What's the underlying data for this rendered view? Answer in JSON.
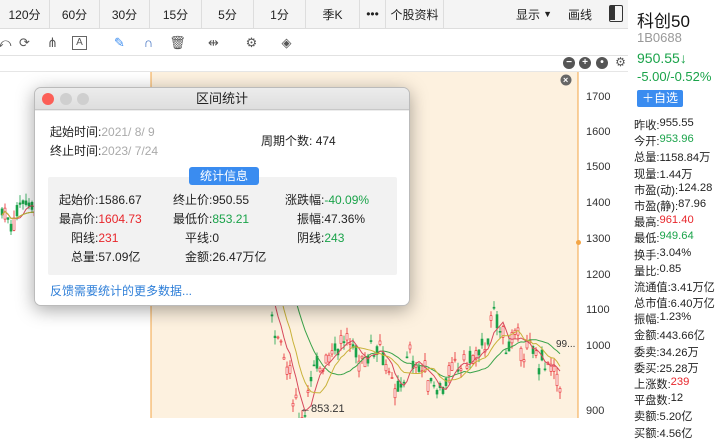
{
  "period_tabs": [
    "120分",
    "60分",
    "30分",
    "15分",
    "5分",
    "1分",
    "季K",
    "•••",
    "个股资料"
  ],
  "period_right": {
    "display": "显示",
    "draw": "画线"
  },
  "icons": {
    "tools": [
      "ellipse-tool-icon",
      "cycle-tool-icon",
      "fork-tool-icon",
      "text-tool-icon",
      "brush-tool-icon",
      "magnet-tool-icon",
      "trash-icon",
      "spread-tool-icon",
      "settings-icon",
      "layers-icon"
    ]
  },
  "yaxis_ticks": [
    "1700",
    "1600",
    "1500",
    "1400",
    "1300",
    "1200",
    "1100",
    "1000",
    "900"
  ],
  "chart_labels": {
    "low_marker": "←853.21",
    "last_price_marker": "99..."
  },
  "stock": {
    "name": "科创50",
    "code": "1B0688",
    "price": "950.55↓",
    "change": "-5.00/-0.52%",
    "add_button": "＋自选",
    "stats": [
      {
        "k": "昨收:",
        "v": "955.55",
        "c": "#222"
      },
      {
        "k": "今开:",
        "v": "953.96",
        "c": "#1aa34a"
      },
      {
        "k": "总量:",
        "v": "1158.84万",
        "c": "#222"
      },
      {
        "k": "现量:",
        "v": "1.44万",
        "c": "#222"
      },
      {
        "k": "市盈(动):",
        "v": "124.28",
        "c": "#222"
      },
      {
        "k": "市盈(静):",
        "v": "87.96",
        "c": "#222"
      },
      {
        "k": "最高:",
        "v": "961.40",
        "c": "#e8262b"
      },
      {
        "k": "最低:",
        "v": "949.64",
        "c": "#1aa34a"
      },
      {
        "k": "换手:",
        "v": "3.04%",
        "c": "#222"
      },
      {
        "k": "量比:",
        "v": "0.85",
        "c": "#222"
      },
      {
        "k": "流通值:",
        "v": "3.41万亿",
        "c": "#222"
      },
      {
        "k": "总市值:",
        "v": "6.40万亿",
        "c": "#222"
      },
      {
        "k": "振幅:",
        "v": "1.23%",
        "c": "#222"
      },
      {
        "k": "金额:",
        "v": "443.66亿",
        "c": "#222"
      },
      {
        "k": "委卖:",
        "v": "34.26万",
        "c": "#222"
      },
      {
        "k": "委买:",
        "v": "25.28万",
        "c": "#222"
      },
      {
        "k": "上涨数:",
        "v": "239",
        "c": "#e8262b"
      },
      {
        "k": "平盘数:",
        "v": "12",
        "c": "#222"
      },
      {
        "k": "卖额:",
        "v": "5.20亿",
        "c": "#222"
      },
      {
        "k": "买额:",
        "v": "4.56亿",
        "c": "#222"
      }
    ]
  },
  "dialog": {
    "title": "区间统计",
    "start_label": "起始时间:",
    "start_value": "2021/ 8/ 9",
    "end_label": "终止时间:",
    "end_value": "2023/ 7/24",
    "period_label": "周期个数:",
    "period_value": "474",
    "info_tag": "统计信息",
    "rows": {
      "start_price_label": "起始价:",
      "start_price": "1586.67",
      "end_price_label": "终止价:",
      "end_price": "950.55",
      "change_label": "涨跌幅:",
      "change": "-40.09%",
      "high_label": "最高价:",
      "high": "1604.73",
      "low_label": "最低价:",
      "low": "853.21",
      "amp_label": "振幅:",
      "amp": "47.36%",
      "up_label": "阳线:",
      "up": "231",
      "flat_label": "平线:",
      "flat": "0",
      "down_label": "阴线:",
      "down": "243",
      "vol_label": "总量:",
      "vol": "57.09亿",
      "amt_label": "金额:",
      "amt": "26.47万亿"
    },
    "link": "反馈需要统计的更多数据..."
  }
}
